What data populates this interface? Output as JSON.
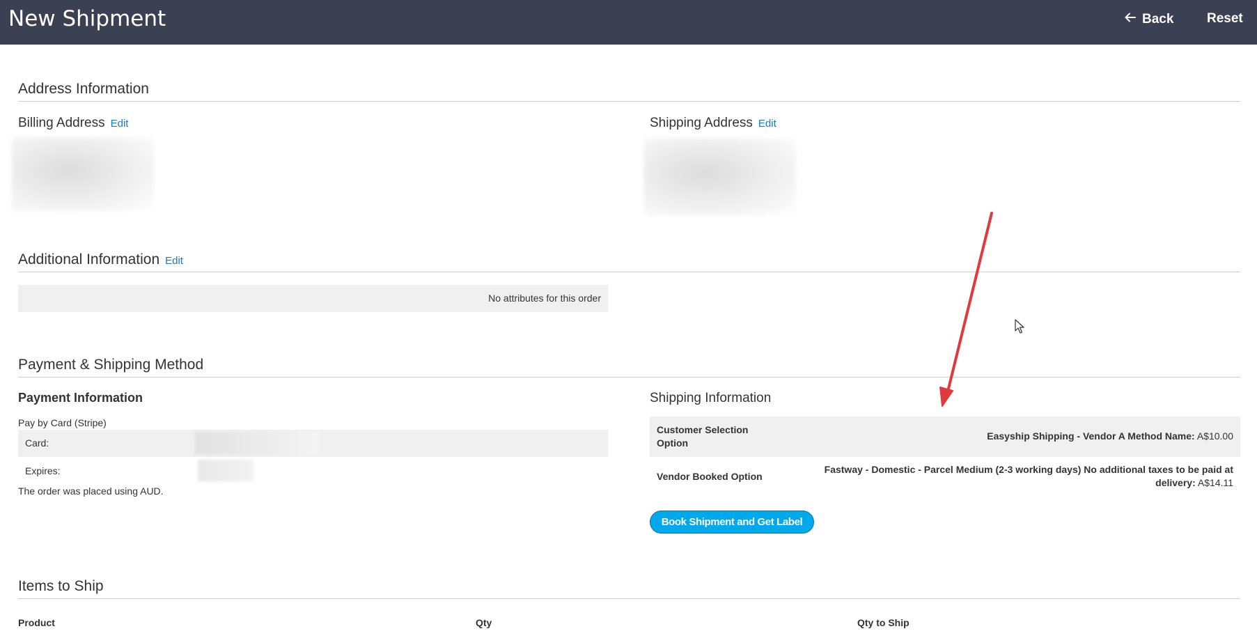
{
  "header": {
    "title": "New Shipment",
    "back_label": "Back",
    "reset_label": "Reset"
  },
  "address": {
    "section_title": "Address Information",
    "billing_title": "Billing Address",
    "shipping_title": "Shipping Address",
    "edit_label": "Edit"
  },
  "additional": {
    "section_title": "Additional Information",
    "edit_label": "Edit",
    "empty_text": "No attributes for this order"
  },
  "payment_shipping": {
    "section_title": "Payment & Shipping Method",
    "payment": {
      "title": "Payment Information",
      "method": "Pay by Card (Stripe)",
      "card_label": "Card:",
      "expires_label": "Expires:",
      "currency_note": "The order was placed using AUD."
    },
    "shipping": {
      "title": "Shipping Information",
      "rows": [
        {
          "label_line1": "Customer Selection",
          "label_line2": "Option",
          "method": "Easyship Shipping - Vendor A Method Name:",
          "price": "A$10.00"
        },
        {
          "label": "Vendor Booked Option",
          "method_line1": "Fastway - Domestic - Parcel Medium (2-3 working days) No additional taxes to be paid at",
          "method_line2": "delivery:",
          "price": "A$14.11"
        }
      ],
      "book_button": "Book Shipment and Get Label"
    }
  },
  "items": {
    "section_title": "Items to Ship",
    "columns": [
      "Product",
      "Qty",
      "Qty to Ship"
    ]
  },
  "colors": {
    "header_bg": "#3b4053",
    "link": "#1979c3",
    "button": "#00a8ec",
    "annotation_arrow": "#e0393e"
  },
  "icons": {
    "back": "arrow-left-icon",
    "cursor": "mouse-pointer-icon"
  }
}
